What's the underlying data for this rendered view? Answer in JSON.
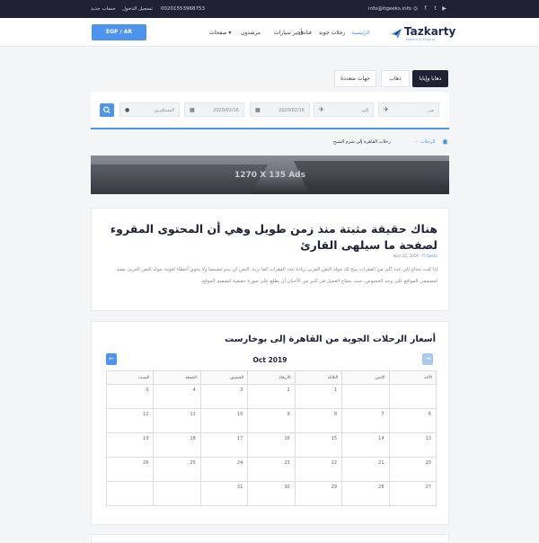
{
  "topbar": {
    "new_account": "حساب جديد",
    "login": "تسجيل الدخول",
    "phone": "00201553968753",
    "email": "info@itgeeks.info",
    "social_icons": [
      "instagram-icon",
      "facebook-icon",
      "twitter-icon",
      "youtube-icon"
    ]
  },
  "header": {
    "currency": "EGP / AR",
    "logo_text": "Tazkarty",
    "logo_sub": "Hotels & Flights",
    "nav": [
      "الرئيسية",
      "رحلات جوية",
      "فنادق",
      "تأجير سيارات",
      "مرشدون",
      "صفحات ▾"
    ]
  },
  "tabs": {
    "round_trip": "ذهابا وإيابا",
    "one_way": "ذهاب",
    "multi_city": "جهات متعددة"
  },
  "search": {
    "from_placeholder": "من",
    "to_placeholder": "إلى",
    "depart_date": "2020/02/16",
    "return_date": "2020/02/16",
    "travelers_placeholder": "المسافرين"
  },
  "breadcrumb": {
    "home_icon": "home-icon",
    "flights": "الرحلات",
    "current": "رحلات القاهرة إلى شرم الشيخ"
  },
  "ads": {
    "label": "1270 X 135 Ads"
  },
  "article": {
    "title": "هناك حقيقة مثبتة منذ زمن طويل وهي أن المحتوى المقروء لصفحة ما سيلهى القارئ",
    "date": "April 22, 2019",
    "author": "IT Geeks",
    "body": "إذا كنت تحتاج إلى عدد أكبر من الفقرات يتيح لك مولد النص العربى زيادة عدد الفقرات كما تريد، النص لن يبدو مقسما ولا يحوي أخطاء لغوية، مولد النص العربى مفيد لمصممي المواقع على وجه الخصوص، حيث يحتاج العميل فى كثير من الأحيان أن يطلع على صورة حقيقية لتصميم الموقع."
  },
  "calendar": {
    "title": "أسعار الرحلات الجوية من القاهرة إلى بوخارست",
    "month": "Oct 2019",
    "days": [
      "الأحد",
      "الإثنين",
      "الثلاثاء",
      "الأربعاء",
      "الخميس",
      "الجمعة",
      "السبت"
    ],
    "weeks": [
      [
        "",
        "",
        "1",
        "2",
        "3",
        "4",
        "5"
      ],
      [
        "6",
        "7",
        "8",
        "9",
        "10",
        "11",
        "12"
      ],
      [
        "13",
        "14",
        "15",
        "16",
        "17",
        "18",
        "19"
      ],
      [
        "20",
        "21",
        "22",
        "23",
        "24",
        "25",
        "26"
      ],
      [
        "27",
        "28",
        "29",
        "30",
        "31",
        "",
        ""
      ]
    ]
  },
  "colors": {
    "accent": "#4c94ed",
    "dark": "#1f2235"
  }
}
